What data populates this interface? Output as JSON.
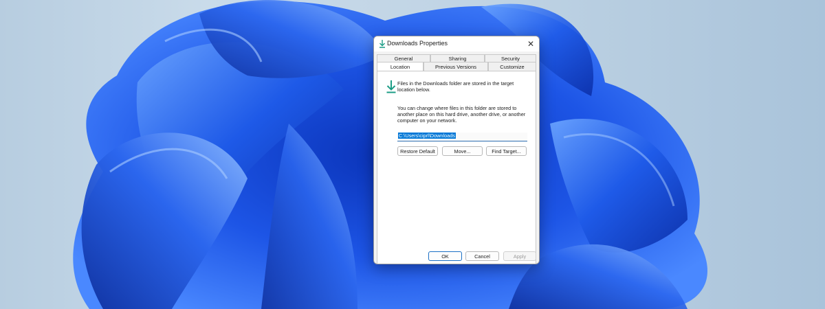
{
  "dialog": {
    "title": "Downloads Properties",
    "close_icon": "close-icon",
    "title_icon": "download-arrow-icon"
  },
  "tabs": {
    "row1": [
      "General",
      "Sharing",
      "Security"
    ],
    "row2": [
      "Location",
      "Previous Versions",
      "Customize"
    ],
    "active": "Location"
  },
  "location": {
    "intro": "Files in the Downloads folder are stored in the target location below.",
    "description": "You can change where files in this folder are stored to another place on this hard drive, another drive, or another computer on your network.",
    "path": "C:\\Users\\ciprl\\Downloads",
    "restore_default_label": "Restore Default",
    "move_label": "Move...",
    "find_target_label": "Find Target..."
  },
  "footer": {
    "ok_label": "OK",
    "cancel_label": "Cancel",
    "apply_label": "Apply"
  },
  "colors": {
    "accent": "#0078d7",
    "wallpaper_blue": "#1f56e0",
    "download_icon": "#1b9c85"
  }
}
